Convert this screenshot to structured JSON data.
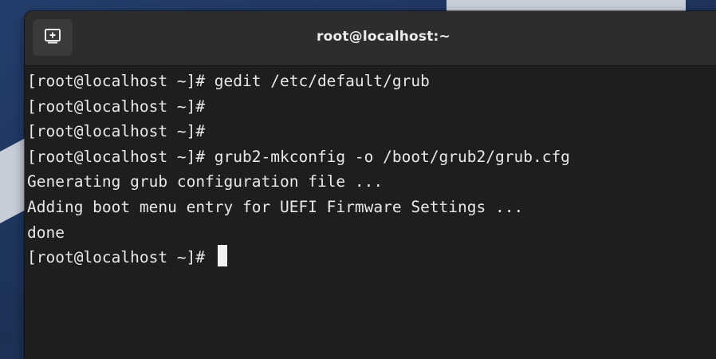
{
  "window": {
    "title": "root@localhost:~"
  },
  "toolbar": {
    "new_tab_icon": "new-tab-icon"
  },
  "terminal": {
    "lines": [
      "[root@localhost ~]# gedit /etc/default/grub",
      "[root@localhost ~]#",
      "[root@localhost ~]#",
      "[root@localhost ~]# grub2-mkconfig -o /boot/grub2/grub.cfg",
      "Generating grub configuration file ...",
      "Adding boot menu entry for UEFI Firmware Settings ...",
      "done",
      "[root@localhost ~]# "
    ]
  },
  "colors": {
    "terminal_bg": "#1e1e1e",
    "header_bg": "#2d2d2d",
    "text": "#e8e8e8",
    "desktop": "#1f3560"
  }
}
